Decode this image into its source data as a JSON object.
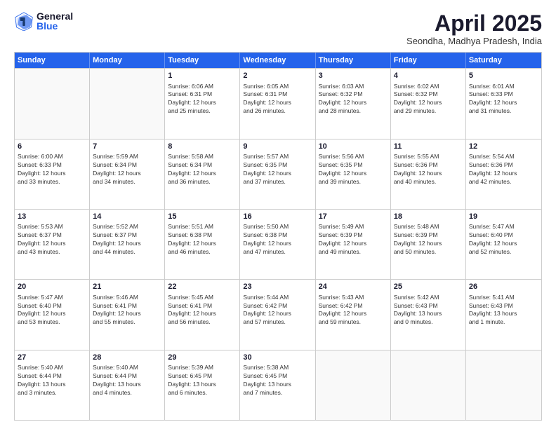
{
  "logo": {
    "general": "General",
    "blue": "Blue"
  },
  "title": "April 2025",
  "location": "Seondha, Madhya Pradesh, India",
  "headers": [
    "Sunday",
    "Monday",
    "Tuesday",
    "Wednesday",
    "Thursday",
    "Friday",
    "Saturday"
  ],
  "rows": [
    [
      {
        "num": "",
        "sunrise": "",
        "sunset": "",
        "daylight": "",
        "empty": true
      },
      {
        "num": "",
        "sunrise": "",
        "sunset": "",
        "daylight": "",
        "empty": true
      },
      {
        "num": "1",
        "sunrise": "Sunrise: 6:06 AM",
        "sunset": "Sunset: 6:31 PM",
        "daylight": "Daylight: 12 hours",
        "daylight2": "and 25 minutes."
      },
      {
        "num": "2",
        "sunrise": "Sunrise: 6:05 AM",
        "sunset": "Sunset: 6:31 PM",
        "daylight": "Daylight: 12 hours",
        "daylight2": "and 26 minutes."
      },
      {
        "num": "3",
        "sunrise": "Sunrise: 6:03 AM",
        "sunset": "Sunset: 6:32 PM",
        "daylight": "Daylight: 12 hours",
        "daylight2": "and 28 minutes."
      },
      {
        "num": "4",
        "sunrise": "Sunrise: 6:02 AM",
        "sunset": "Sunset: 6:32 PM",
        "daylight": "Daylight: 12 hours",
        "daylight2": "and 29 minutes."
      },
      {
        "num": "5",
        "sunrise": "Sunrise: 6:01 AM",
        "sunset": "Sunset: 6:33 PM",
        "daylight": "Daylight: 12 hours",
        "daylight2": "and 31 minutes."
      }
    ],
    [
      {
        "num": "6",
        "sunrise": "Sunrise: 6:00 AM",
        "sunset": "Sunset: 6:33 PM",
        "daylight": "Daylight: 12 hours",
        "daylight2": "and 33 minutes."
      },
      {
        "num": "7",
        "sunrise": "Sunrise: 5:59 AM",
        "sunset": "Sunset: 6:34 PM",
        "daylight": "Daylight: 12 hours",
        "daylight2": "and 34 minutes."
      },
      {
        "num": "8",
        "sunrise": "Sunrise: 5:58 AM",
        "sunset": "Sunset: 6:34 PM",
        "daylight": "Daylight: 12 hours",
        "daylight2": "and 36 minutes."
      },
      {
        "num": "9",
        "sunrise": "Sunrise: 5:57 AM",
        "sunset": "Sunset: 6:35 PM",
        "daylight": "Daylight: 12 hours",
        "daylight2": "and 37 minutes."
      },
      {
        "num": "10",
        "sunrise": "Sunrise: 5:56 AM",
        "sunset": "Sunset: 6:35 PM",
        "daylight": "Daylight: 12 hours",
        "daylight2": "and 39 minutes."
      },
      {
        "num": "11",
        "sunrise": "Sunrise: 5:55 AM",
        "sunset": "Sunset: 6:36 PM",
        "daylight": "Daylight: 12 hours",
        "daylight2": "and 40 minutes."
      },
      {
        "num": "12",
        "sunrise": "Sunrise: 5:54 AM",
        "sunset": "Sunset: 6:36 PM",
        "daylight": "Daylight: 12 hours",
        "daylight2": "and 42 minutes."
      }
    ],
    [
      {
        "num": "13",
        "sunrise": "Sunrise: 5:53 AM",
        "sunset": "Sunset: 6:37 PM",
        "daylight": "Daylight: 12 hours",
        "daylight2": "and 43 minutes."
      },
      {
        "num": "14",
        "sunrise": "Sunrise: 5:52 AM",
        "sunset": "Sunset: 6:37 PM",
        "daylight": "Daylight: 12 hours",
        "daylight2": "and 44 minutes."
      },
      {
        "num": "15",
        "sunrise": "Sunrise: 5:51 AM",
        "sunset": "Sunset: 6:38 PM",
        "daylight": "Daylight: 12 hours",
        "daylight2": "and 46 minutes."
      },
      {
        "num": "16",
        "sunrise": "Sunrise: 5:50 AM",
        "sunset": "Sunset: 6:38 PM",
        "daylight": "Daylight: 12 hours",
        "daylight2": "and 47 minutes."
      },
      {
        "num": "17",
        "sunrise": "Sunrise: 5:49 AM",
        "sunset": "Sunset: 6:39 PM",
        "daylight": "Daylight: 12 hours",
        "daylight2": "and 49 minutes."
      },
      {
        "num": "18",
        "sunrise": "Sunrise: 5:48 AM",
        "sunset": "Sunset: 6:39 PM",
        "daylight": "Daylight: 12 hours",
        "daylight2": "and 50 minutes."
      },
      {
        "num": "19",
        "sunrise": "Sunrise: 5:47 AM",
        "sunset": "Sunset: 6:40 PM",
        "daylight": "Daylight: 12 hours",
        "daylight2": "and 52 minutes."
      }
    ],
    [
      {
        "num": "20",
        "sunrise": "Sunrise: 5:47 AM",
        "sunset": "Sunset: 6:40 PM",
        "daylight": "Daylight: 12 hours",
        "daylight2": "and 53 minutes."
      },
      {
        "num": "21",
        "sunrise": "Sunrise: 5:46 AM",
        "sunset": "Sunset: 6:41 PM",
        "daylight": "Daylight: 12 hours",
        "daylight2": "and 55 minutes."
      },
      {
        "num": "22",
        "sunrise": "Sunrise: 5:45 AM",
        "sunset": "Sunset: 6:41 PM",
        "daylight": "Daylight: 12 hours",
        "daylight2": "and 56 minutes."
      },
      {
        "num": "23",
        "sunrise": "Sunrise: 5:44 AM",
        "sunset": "Sunset: 6:42 PM",
        "daylight": "Daylight: 12 hours",
        "daylight2": "and 57 minutes."
      },
      {
        "num": "24",
        "sunrise": "Sunrise: 5:43 AM",
        "sunset": "Sunset: 6:42 PM",
        "daylight": "Daylight: 12 hours",
        "daylight2": "and 59 minutes."
      },
      {
        "num": "25",
        "sunrise": "Sunrise: 5:42 AM",
        "sunset": "Sunset: 6:43 PM",
        "daylight": "Daylight: 13 hours",
        "daylight2": "and 0 minutes."
      },
      {
        "num": "26",
        "sunrise": "Sunrise: 5:41 AM",
        "sunset": "Sunset: 6:43 PM",
        "daylight": "Daylight: 13 hours",
        "daylight2": "and 1 minute."
      }
    ],
    [
      {
        "num": "27",
        "sunrise": "Sunrise: 5:40 AM",
        "sunset": "Sunset: 6:44 PM",
        "daylight": "Daylight: 13 hours",
        "daylight2": "and 3 minutes."
      },
      {
        "num": "28",
        "sunrise": "Sunrise: 5:40 AM",
        "sunset": "Sunset: 6:44 PM",
        "daylight": "Daylight: 13 hours",
        "daylight2": "and 4 minutes."
      },
      {
        "num": "29",
        "sunrise": "Sunrise: 5:39 AM",
        "sunset": "Sunset: 6:45 PM",
        "daylight": "Daylight: 13 hours",
        "daylight2": "and 6 minutes."
      },
      {
        "num": "30",
        "sunrise": "Sunrise: 5:38 AM",
        "sunset": "Sunset: 6:45 PM",
        "daylight": "Daylight: 13 hours",
        "daylight2": "and 7 minutes."
      },
      {
        "num": "",
        "sunrise": "",
        "sunset": "",
        "daylight": "",
        "daylight2": "",
        "empty": true
      },
      {
        "num": "",
        "sunrise": "",
        "sunset": "",
        "daylight": "",
        "daylight2": "",
        "empty": true
      },
      {
        "num": "",
        "sunrise": "",
        "sunset": "",
        "daylight": "",
        "daylight2": "",
        "empty": true
      }
    ]
  ]
}
